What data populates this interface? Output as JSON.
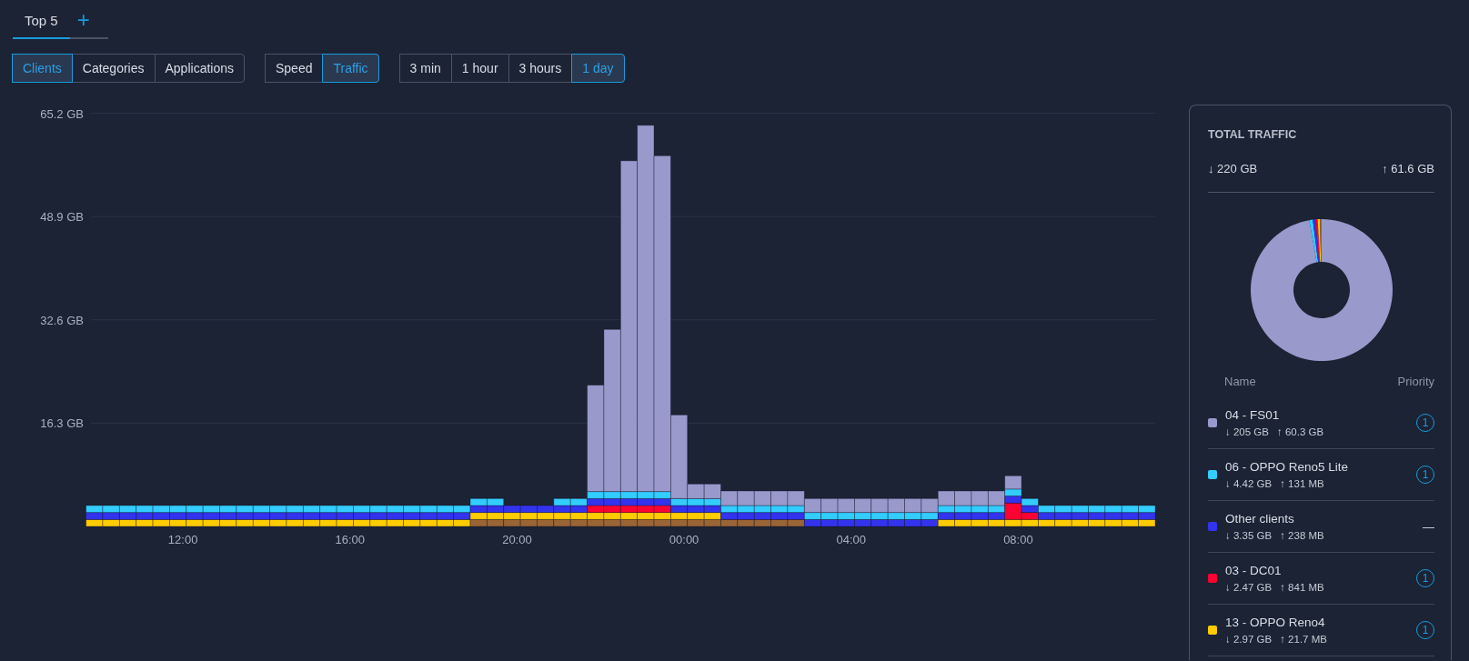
{
  "tabs": [
    {
      "label": "Top 5",
      "selected": true
    }
  ],
  "add_tab": "+",
  "filters": [
    {
      "buttons": [
        {
          "label": "Clients",
          "selected": true
        },
        {
          "label": "Categories",
          "selected": false
        },
        {
          "label": "Applications",
          "selected": false
        }
      ]
    },
    {
      "buttons": [
        {
          "label": "Speed",
          "selected": false
        },
        {
          "label": "Traffic",
          "selected": true
        }
      ]
    },
    {
      "buttons": [
        {
          "label": "3 min",
          "selected": false
        },
        {
          "label": "1 hour",
          "selected": false
        },
        {
          "label": "3 hours",
          "selected": false
        },
        {
          "label": "1 day",
          "selected": true
        }
      ]
    }
  ],
  "chart": {
    "chart_data": {
      "type": "bar",
      "stacked": true,
      "categories": [
        null,
        null,
        null,
        null,
        null,
        "12:00",
        null,
        null,
        null,
        null,
        null,
        null,
        null,
        null,
        null,
        "16:00",
        null,
        null,
        null,
        null,
        null,
        null,
        null,
        null,
        null,
        "20:00",
        null,
        null,
        null,
        null,
        null,
        null,
        null,
        null,
        null,
        "00:00",
        null,
        null,
        null,
        null,
        null,
        null,
        null,
        null,
        null,
        "04:00",
        null,
        null,
        null,
        null,
        null,
        null,
        null,
        null,
        null,
        "08:00",
        null,
        null,
        null,
        null,
        null,
        null,
        null,
        null
      ],
      "ylim": [
        0,
        65.2
      ],
      "grid": true,
      "yticks": [
        {
          "value": 16.3,
          "label": "16.3 GB"
        },
        {
          "value": 32.6,
          "label": "32.6 GB"
        },
        {
          "value": 48.9,
          "label": "48.9 GB"
        },
        {
          "value": 65.2,
          "label": "65.2 GB"
        }
      ],
      "series": [
        {
          "color": "#9999cc",
          "values": [
            null,
            null,
            null,
            null,
            null,
            null,
            null,
            null,
            null,
            null,
            null,
            null,
            null,
            null,
            null,
            null,
            null,
            null,
            null,
            null,
            null,
            null,
            null,
            null,
            null,
            null,
            null,
            null,
            null,
            null,
            16.8,
            25.6,
            52.2,
            57.8,
            53.0,
            13.2,
            2.3,
            2.3,
            2.3,
            2.3,
            2.3,
            2.3,
            2.3,
            2.2,
            2.2,
            2.2,
            2.2,
            2.2,
            2.2,
            2.2,
            2.2,
            2.3,
            2.3,
            2.3,
            2.3,
            2.1,
            null,
            null,
            null,
            null,
            null,
            null,
            null,
            null
          ]
        },
        {
          "color": "#33ccff",
          "values": [
            1.1,
            1.1,
            1.1,
            1.1,
            1.1,
            1.1,
            1.1,
            1.1,
            1.1,
            1.1,
            1.1,
            1.1,
            1.1,
            1.1,
            1.1,
            1.1,
            1.1,
            1.1,
            1.1,
            1.1,
            1.1,
            1.1,
            1.1,
            1.1,
            1.1,
            null,
            null,
            null,
            1.1,
            1.1,
            1.1,
            1.1,
            1.1,
            1.1,
            1.1,
            1.1,
            1.1,
            1.1,
            1.1,
            1.1,
            1.1,
            1.1,
            1.1,
            1.1,
            1.1,
            1.1,
            1.1,
            1.1,
            1.1,
            1.1,
            1.1,
            1.1,
            1.1,
            1.1,
            1.1,
            1.1,
            1.1,
            1.1,
            1.1,
            1.1,
            1.1,
            1.1,
            1.1,
            1.1
          ]
        },
        {
          "color": "#3333ee",
          "values": [
            1.1,
            1.1,
            1.1,
            1.1,
            1.1,
            1.1,
            1.1,
            1.1,
            1.1,
            1.1,
            1.1,
            1.1,
            1.1,
            1.1,
            1.1,
            1.1,
            1.1,
            1.1,
            1.1,
            1.1,
            1.1,
            1.1,
            1.1,
            1.1,
            1.1,
            1.1,
            1.1,
            1.1,
            1.1,
            1.1,
            1.1,
            1.1,
            1.1,
            1.1,
            1.1,
            1.1,
            1.1,
            1.1,
            1.1,
            1.1,
            1.1,
            1.1,
            1.1,
            1.1,
            1.1,
            1.1,
            1.1,
            1.1,
            1.1,
            1.1,
            1.1,
            1.1,
            1.1,
            1.1,
            1.1,
            1.1,
            1.1,
            1.1,
            1.1,
            1.1,
            1.1,
            1.1,
            1.1,
            1.1
          ]
        },
        {
          "color": "#ff0033",
          "values": [
            null,
            null,
            null,
            null,
            null,
            null,
            null,
            null,
            null,
            null,
            null,
            null,
            null,
            null,
            null,
            null,
            null,
            null,
            null,
            null,
            null,
            null,
            null,
            null,
            null,
            null,
            null,
            null,
            null,
            null,
            1.1,
            1.1,
            1.1,
            1.1,
            1.1,
            null,
            null,
            null,
            null,
            null,
            null,
            null,
            null,
            null,
            null,
            null,
            null,
            null,
            null,
            null,
            null,
            null,
            null,
            null,
            null,
            2.6,
            1.1,
            null,
            null,
            null,
            null,
            null,
            null,
            null
          ]
        },
        {
          "color": "#ffcc00",
          "values": [
            1.1,
            1.1,
            1.1,
            1.1,
            1.1,
            1.1,
            1.1,
            1.1,
            1.1,
            1.1,
            1.1,
            1.1,
            1.1,
            1.1,
            1.1,
            1.1,
            1.1,
            1.1,
            1.1,
            1.1,
            1.1,
            1.1,
            1.1,
            1.1,
            1.1,
            1.1,
            1.1,
            1.1,
            1.1,
            1.1,
            1.1,
            1.1,
            1.1,
            1.1,
            1.1,
            1.1,
            1.1,
            1.1,
            null,
            null,
            null,
            null,
            null,
            null,
            null,
            null,
            null,
            null,
            null,
            null,
            null,
            1.1,
            1.1,
            1.1,
            1.1,
            1.1,
            1.1,
            1.1,
            1.1,
            1.1,
            1.1,
            1.1,
            1.1,
            1.1
          ]
        },
        {
          "color": "#9a6434",
          "values": [
            null,
            null,
            null,
            null,
            null,
            null,
            null,
            null,
            null,
            null,
            null,
            null,
            null,
            null,
            null,
            null,
            null,
            null,
            null,
            null,
            null,
            null,
            null,
            1.1,
            1.1,
            1.1,
            1.1,
            1.1,
            1.1,
            1.1,
            1.1,
            1.1,
            1.1,
            1.1,
            1.1,
            1.1,
            1.1,
            1.1,
            1.1,
            1.1,
            1.1,
            1.1,
            1.1,
            null,
            null,
            null,
            null,
            null,
            null,
            null,
            null,
            null,
            null,
            null,
            null,
            null,
            null,
            null,
            null,
            null,
            null,
            null,
            null,
            null
          ]
        }
      ]
    }
  },
  "panel": {
    "title": "TOTAL TRAFFIC",
    "total_down": "↓ 220 GB",
    "total_up": "↑ 61.6 GB",
    "columns": [
      "Name",
      "Priority"
    ],
    "clients": [
      {
        "name": "04 - FS01",
        "down": "↓ 205 GB",
        "up": "↑ 60.3 GB",
        "color": "#9999cc",
        "kind": "rated",
        "priority": "1"
      },
      {
        "name": "06 - OPPO Reno5 Lite",
        "down": "↓ 4.42 GB",
        "up": "↑ 131 MB",
        "color": "#33ccff",
        "kind": "rated",
        "priority": "1"
      },
      {
        "name": "Other clients",
        "down": "↓ 3.35 GB",
        "up": "↑ 238 MB",
        "color": "#3333ee",
        "kind": "group",
        "priority": "—"
      },
      {
        "name": "03 - DC01",
        "down": "↓ 2.47 GB",
        "up": "↑ 841 MB",
        "color": "#ff0033",
        "kind": "rated",
        "priority": "1"
      },
      {
        "name": "13 - OPPO Reno4",
        "down": "↓ 2.97 GB",
        "up": "↑ 21.7 MB",
        "color": "#ffcc00",
        "kind": "rated",
        "priority": "1"
      }
    ]
  }
}
